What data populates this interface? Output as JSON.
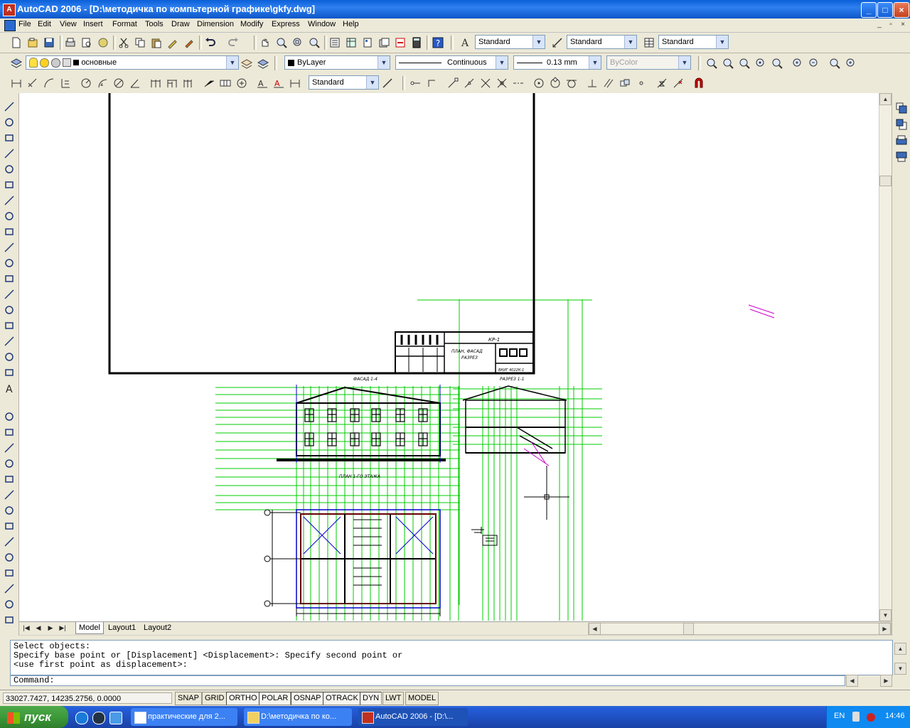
{
  "window": {
    "title": "AutoCAD 2006 - [D:\\методичка по компьтерной графике\\gkfy.dwg]",
    "min_label": "_",
    "max_label": "□",
    "close_label": "×"
  },
  "menu": {
    "items": [
      "File",
      "Edit",
      "View",
      "Insert",
      "Format",
      "Tools",
      "Draw",
      "Dimension",
      "Modify",
      "Express",
      "Window",
      "Help"
    ],
    "mdi_controls": [
      "_",
      "▫",
      "×"
    ]
  },
  "toolbar1": {
    "text_style": "Standard",
    "dim_style": "Standard",
    "table_style": "Standard"
  },
  "toolbar2": {
    "layer": "основные",
    "color": "ByLayer",
    "linetype": "Continuous",
    "lineweight": "0.13 mm",
    "plotstyle": "ByColor"
  },
  "toolbar3": {
    "dim_style": "Standard"
  },
  "drawing": {
    "plan_title": "ФАСАД 1-4",
    "section_title": "РАЗРЕЗ 1-1",
    "floor_plan_title": "ПЛАН 1-ГО ЭТАЖА",
    "stamp_code": "КР-1",
    "stamp_text_1": "ПЛАН, ФАСАД",
    "stamp_text_2": "РАЗРЕЗ",
    "stamp_text_3": "ВКИГ 4022К-1"
  },
  "tabs": {
    "nav": [
      "|◀",
      "◀",
      "▶",
      "▶|"
    ],
    "items": [
      "Model",
      "Layout1",
      "Layout2"
    ],
    "active": "Model"
  },
  "command": {
    "history": "Select objects:\nSpecify base point or [Displacement] <Displacement>: Specify second point or\n<use first point as displacement>:",
    "prompt": "Command:"
  },
  "status": {
    "coords": "33027.7427, 14235.2756, 0.0000",
    "toggles": [
      "SNAP",
      "GRID",
      "ORTHO",
      "POLAR",
      "OSNAP",
      "OTRACK",
      "DYN",
      "LWT",
      "MODEL"
    ]
  },
  "taskbar": {
    "start": "пуск",
    "tasks": [
      "практические для 2...",
      "D:\\методичка по ко...",
      "AutoCAD 2006 - [D:\\..."
    ],
    "lang": "EN",
    "time": "14:46"
  },
  "colors": {
    "titlebar": "#0a5fd8",
    "green_lines": "#00cc00",
    "blue_lines": "#0000cc",
    "red_lines": "#cc0000",
    "magenta": "#cc00cc"
  }
}
